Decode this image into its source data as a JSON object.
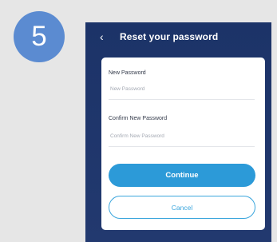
{
  "step": {
    "number": "5"
  },
  "header": {
    "back_glyph": "‹",
    "title": "Reset your password"
  },
  "form": {
    "new_password_label": "New Password",
    "new_password_placeholder": "New Password",
    "confirm_password_label": "Confirm New Password",
    "confirm_password_placeholder": "Confirm New Password"
  },
  "buttons": {
    "continue": "Continue",
    "cancel": "Cancel"
  },
  "colors": {
    "badge": "#5b8bd1",
    "header_bg": "#1c3368",
    "primary": "#2c9ad8",
    "card_bg": "#ffffff"
  }
}
